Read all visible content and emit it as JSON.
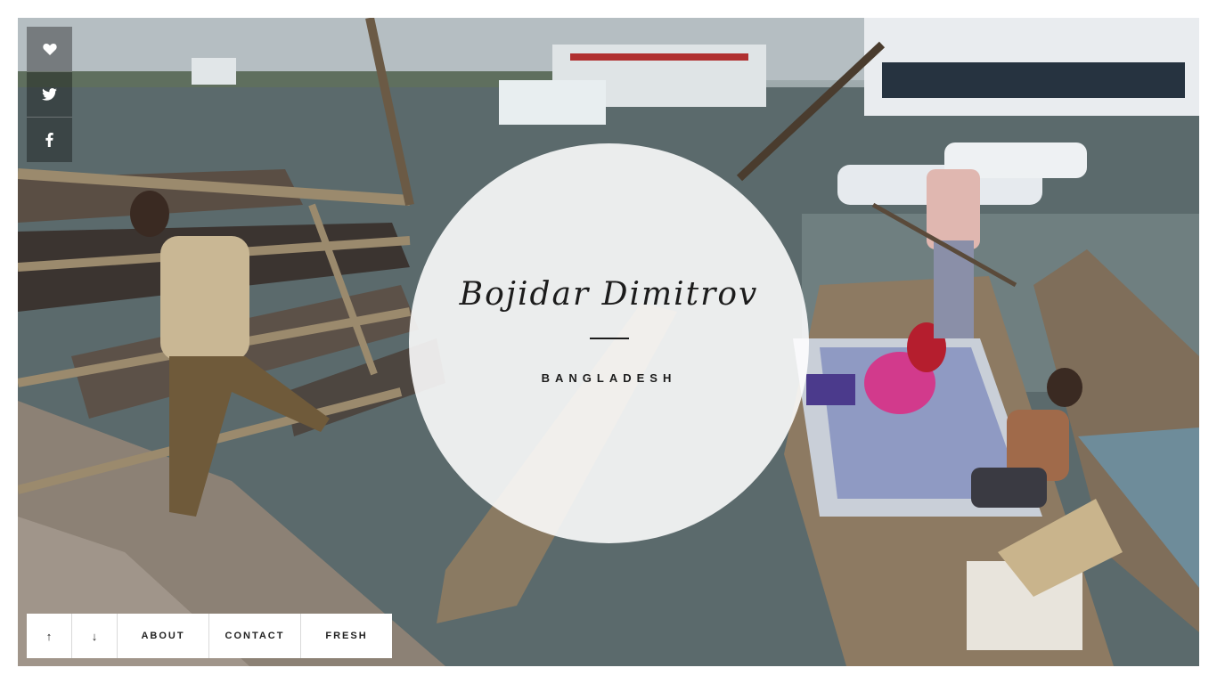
{
  "hero": {
    "title": "Bojidar Dimitrov",
    "subtitle": "BANGLADESH",
    "image_alt": "Boats and people at a river harbour in Bangladesh"
  },
  "share": {
    "icons": [
      "heart-icon",
      "twitter-icon",
      "facebook-icon"
    ]
  },
  "nav": {
    "up": "↑",
    "down": "↓",
    "about": "ABOUT",
    "contact": "CONTACT",
    "fresh": "FRESH"
  },
  "colors": {
    "overlay": "#ffffff",
    "text": "#1c1c1c",
    "share_bg": "rgba(0,0,0,0.35)"
  }
}
